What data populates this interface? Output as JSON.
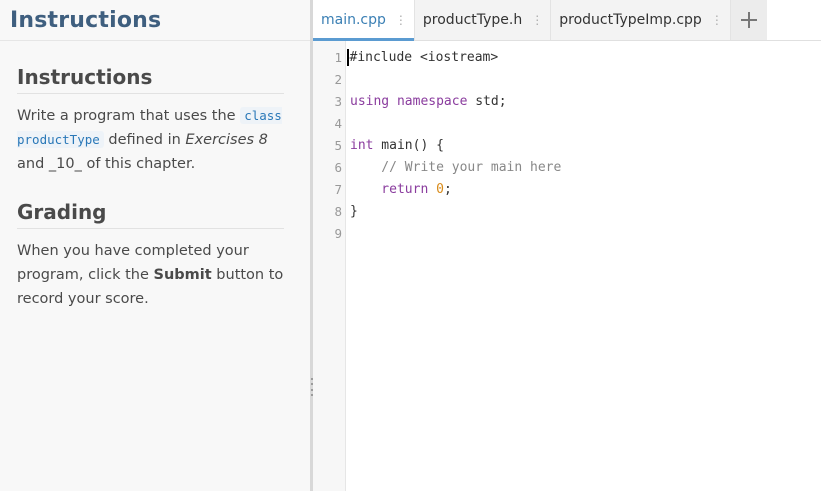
{
  "left_panel": {
    "header_title": "Instructions",
    "instructions_heading": "Instructions",
    "instructions_text_1": "Write a program that uses the",
    "instructions_code": "class productType",
    "instructions_text_2": "defined in",
    "instructions_italic": "Exercises 8",
    "instructions_text_3": "and _10_ of this chapter.",
    "grading_heading": "Grading",
    "grading_text_1": "When you have completed your program, click the",
    "grading_bold": "Submit",
    "grading_text_2": "button to record your score."
  },
  "tabs": [
    {
      "label": "main.cpp",
      "active": true
    },
    {
      "label": "productType.h",
      "active": false
    },
    {
      "label": "productTypeImp.cpp",
      "active": false
    }
  ],
  "tab_menu_glyph": "⋮",
  "editor": {
    "lines": [
      {
        "num": "1",
        "text": "#include <iostream>"
      },
      {
        "num": "2",
        "text": ""
      },
      {
        "num": "3",
        "kw": "using namespace",
        "text": " std;"
      },
      {
        "num": "4",
        "text": ""
      },
      {
        "num": "5",
        "kw": "int",
        "text": " main() {"
      },
      {
        "num": "6",
        "comment": "    // Write your main here"
      },
      {
        "num": "7",
        "kw": "    return",
        "num_lit": " 0",
        "text": ";"
      },
      {
        "num": "8",
        "text": "}"
      },
      {
        "num": "9",
        "text": ""
      }
    ]
  },
  "colors": {
    "accent": "#5b9bd1",
    "title": "#3f5f7f",
    "keyword": "#8a3c9e",
    "number": "#d98b1a"
  }
}
